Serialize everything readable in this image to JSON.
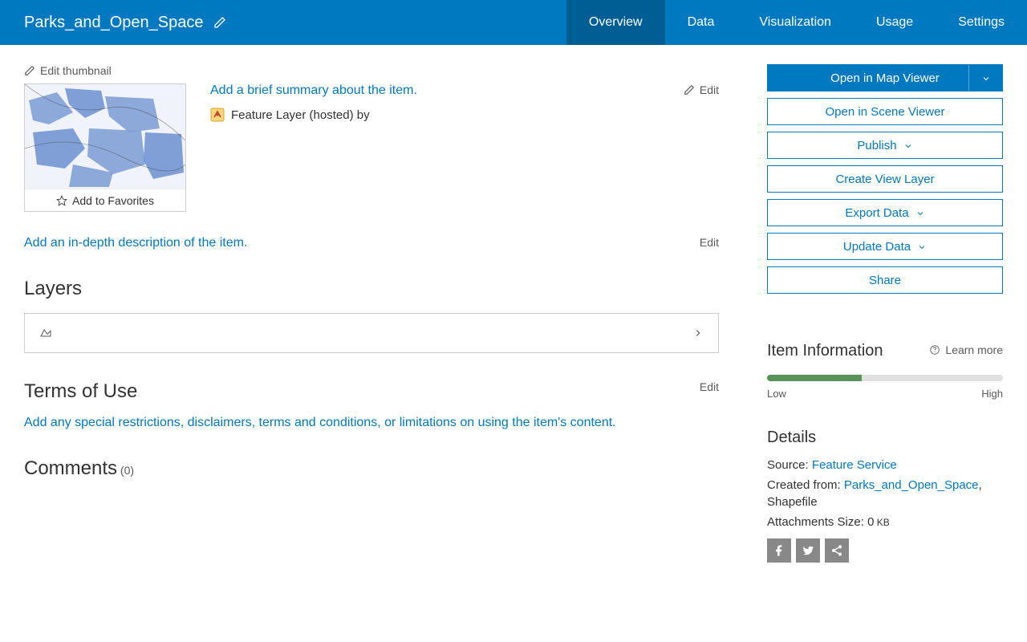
{
  "title": "Parks_and_Open_Space",
  "nav": {
    "overview": "Overview",
    "data": "Data",
    "visualization": "Visualization",
    "usage": "Usage",
    "settings": "Settings"
  },
  "edit_thumbnail": "Edit thumbnail",
  "add_to_favorites": "Add to Favorites",
  "summary_prompt": "Add a brief summary about the item.",
  "item_type": "Feature Layer (hosted) by",
  "edit_label": "Edit",
  "description_prompt": "Add an in-depth description of the item.",
  "layers_heading": "Layers",
  "terms_heading": "Terms of Use",
  "terms_prompt": "Add any special restrictions, disclaimers, terms and conditions, or limitations on using the item's content.",
  "comments_heading": "Comments",
  "comments_count": "(0)",
  "actions": {
    "open_map": "Open in Map Viewer",
    "open_scene": "Open in Scene Viewer",
    "publish": "Publish",
    "create_view": "Create View Layer",
    "export": "Export Data",
    "update": "Update Data",
    "share": "Share"
  },
  "item_info": {
    "heading": "Item Information",
    "learn_more": "Learn more",
    "low": "Low",
    "high": "High",
    "progress_percent": 40
  },
  "details": {
    "heading": "Details",
    "source_label": "Source: ",
    "source_link": "Feature Service",
    "created_label": "Created from: ",
    "created_link": "Parks_and_Open_Space",
    "created_suffix": ", Shapefile",
    "attachments_label": "Attachments Size: ",
    "attachments_value": "0",
    "attachments_unit": " KB"
  }
}
